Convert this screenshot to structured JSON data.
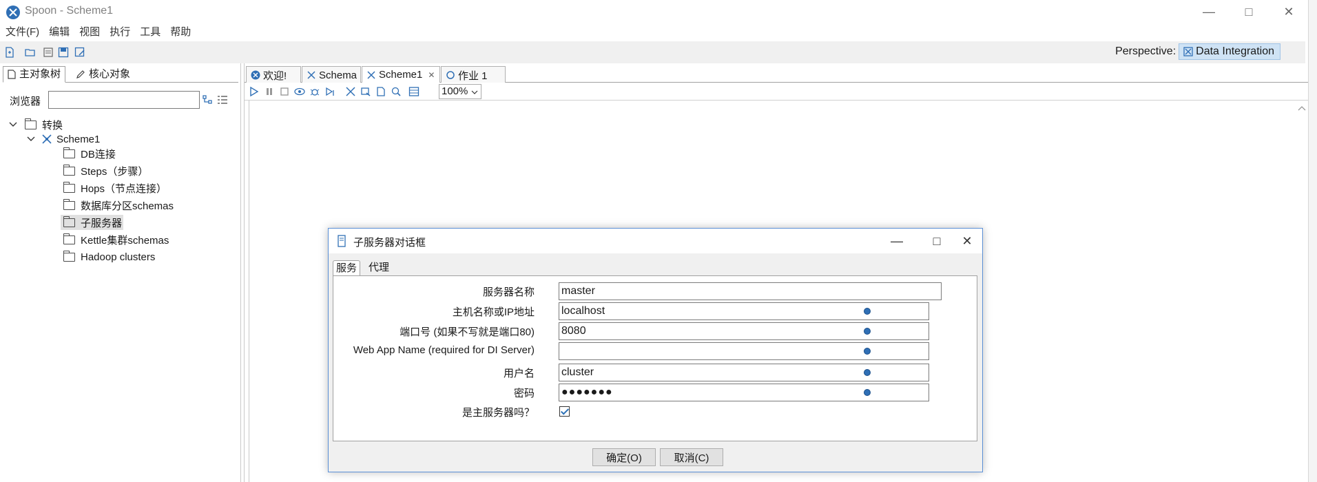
{
  "window": {
    "title": "Spoon - Scheme1"
  },
  "menu": [
    "文件(F)",
    "编辑",
    "视图",
    "执行",
    "工具",
    "帮助"
  ],
  "perspective": {
    "label": "Perspective:",
    "button": "Data Integration"
  },
  "left_tabs": [
    "主对象树",
    "核心对象"
  ],
  "browser": {
    "label": "浏览器",
    "value": ""
  },
  "tree": {
    "root": "转换",
    "transform": "Scheme1",
    "children": [
      "DB连接",
      "Steps（步骤）",
      "Hops（节点连接）",
      "数据库分区schemas",
      "子服务器",
      "Kettle集群schemas",
      "Hadoop clusters"
    ]
  },
  "doc_tabs": [
    "欢迎!",
    "Schema",
    "Scheme1",
    "作业 1"
  ],
  "zoom": "100%",
  "dialog": {
    "title": "子服务器对话框",
    "tabs": [
      "服务",
      "代理"
    ],
    "fields": [
      {
        "label": "服务器名称",
        "value": "master"
      },
      {
        "label": "主机名称或IP地址",
        "value": "localhost"
      },
      {
        "label": "端口号 (如果不写就是端口80)",
        "value": "8080"
      },
      {
        "label": "Web App Name (required for DI Server)",
        "value": ""
      },
      {
        "label": "用户名",
        "value": "cluster"
      },
      {
        "label": "密码",
        "value": "●●●●●●●"
      }
    ],
    "is_master_label": "是主服务器吗？",
    "is_master_checked": true,
    "ok_button": "确定(O)",
    "cancel_button": "取消(C)"
  },
  "colors": {
    "accent": "#2f6fb5",
    "perspective_bg": "#cfe3f5",
    "dialog_border": "#5a8fd6"
  }
}
